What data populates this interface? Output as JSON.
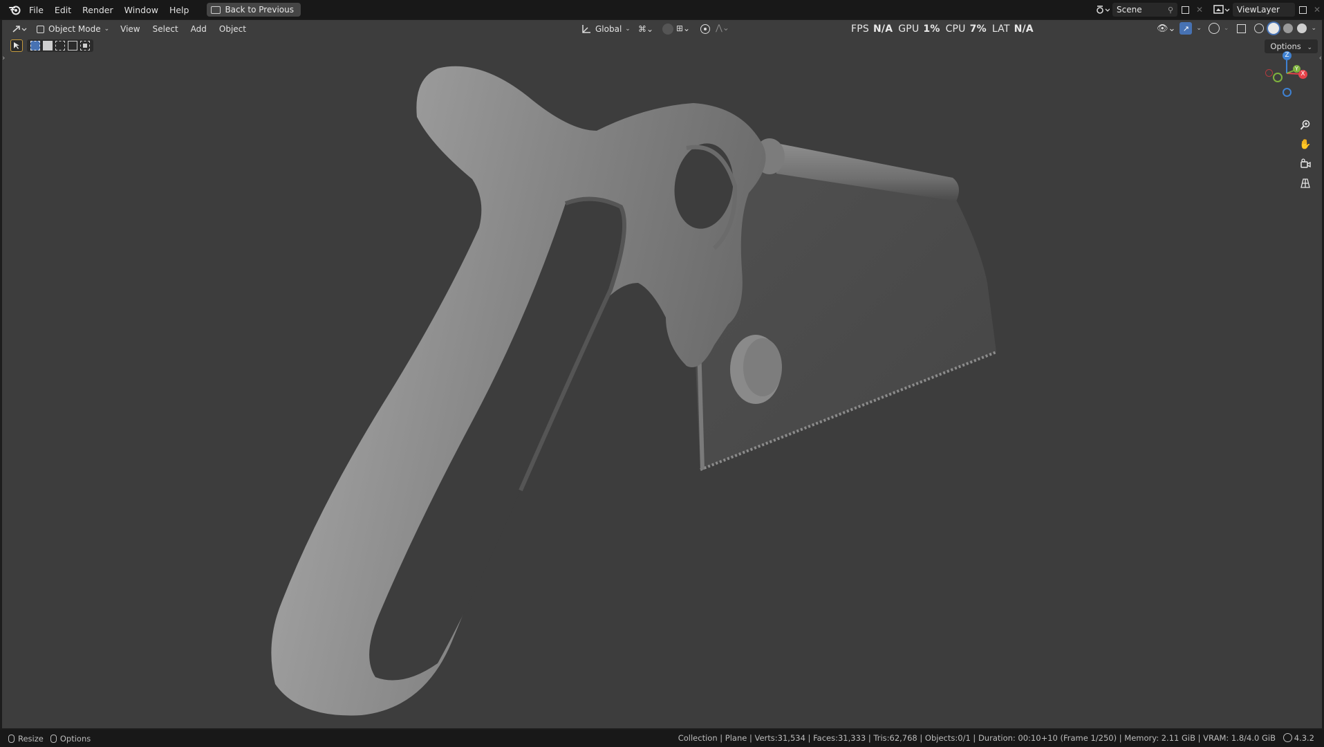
{
  "menu": [
    "File",
    "Edit",
    "Render",
    "Window",
    "Help"
  ],
  "back_button": "Back to Previous",
  "scene": {
    "name": "Scene"
  },
  "view_layer": {
    "name": "ViewLayer"
  },
  "viewport_header": {
    "mode": "Object Mode",
    "menus": [
      "View",
      "Select",
      "Add",
      "Object"
    ],
    "orientation": "Global"
  },
  "stats": {
    "fps_label": "FPS",
    "fps": "N/A",
    "gpu_label": "GPU",
    "gpu": "1%",
    "cpu_label": "CPU",
    "cpu": "7%",
    "lat_label": "LAT",
    "lat": "N/A"
  },
  "options_label": "Options",
  "gizmo": {
    "z": "Z",
    "y": "Y",
    "x": "X"
  },
  "statusbar": {
    "resize": "Resize",
    "options": "Options",
    "info": "Collection | Plane | Verts:31,534 | Faces:31,333 | Tris:62,768 | Objects:0/1 | Duration: 00:10+10 (Frame 1/250) | Memory: 2.11 GiB | VRAM: 1.8/4.0 GiB",
    "version": "4.3.2"
  },
  "colors": {
    "accent": "#4772b3",
    "viewport_bg": "#3d3d3d",
    "bar_bg": "#181818",
    "axis_x": "#e5424a",
    "axis_y": "#7fb23e",
    "axis_z": "#3f82d3"
  },
  "icons": [
    "blender-logo-icon",
    "editor-type-icon",
    "object-mode-icon",
    "transform-orientation-icon",
    "snap-icon",
    "proportional-editing-icon",
    "visibility-icon",
    "gizmo-icon",
    "overlay-icon",
    "xray-icon",
    "shading-icon",
    "zoom-icon",
    "hand-pan-icon",
    "camera-icon",
    "perspective-grid-icon"
  ]
}
